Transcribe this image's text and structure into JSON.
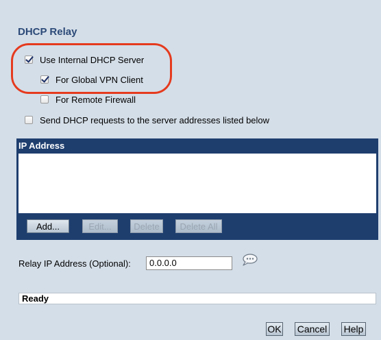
{
  "dialog": {
    "title": "DHCP Relay"
  },
  "options": {
    "use_internal": {
      "label": "Use Internal DHCP Server",
      "checked": true
    },
    "global_vpn": {
      "label": "For Global VPN Client",
      "checked": true
    },
    "remote_firewall": {
      "label": "For Remote Firewall",
      "checked": false
    },
    "send_requests": {
      "label": "Send DHCP requests to the server addresses listed below",
      "checked": false
    }
  },
  "ip_table": {
    "header": "IP Address",
    "rows": [],
    "buttons": {
      "add": "Add...",
      "edit": "Edit...",
      "delete": "Delete",
      "delete_all": "Delete All"
    }
  },
  "relay": {
    "label": "Relay IP Address (Optional):",
    "value": "0.0.0.0",
    "icon": "speech-bubble-icon"
  },
  "status": {
    "text": "Ready"
  },
  "footer": {
    "ok": "OK",
    "cancel": "Cancel",
    "help": "Help"
  },
  "colors": {
    "accent": "#1e3e6e",
    "highlight_ring": "#e53a1e",
    "title": "#2c4a78",
    "background": "#d4dee8"
  }
}
